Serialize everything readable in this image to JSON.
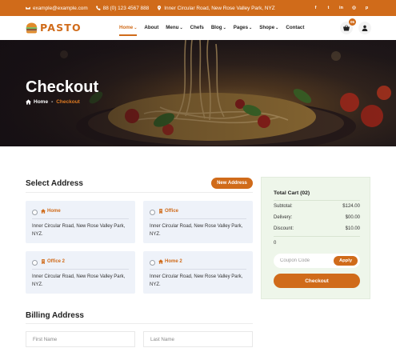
{
  "topbar": {
    "email": "example@example.com",
    "phone": "88 (0) 123 4567 888",
    "address": "Inner Circular Road, New Rose Valley Park, NYZ",
    "social_icons": [
      "facebook-icon",
      "twitter-icon",
      "linkedin-icon",
      "instagram-icon",
      "pinterest-icon"
    ],
    "social_glyphs": {
      "facebook": "f",
      "twitter": "t",
      "linkedin": "in",
      "instagram": "◎",
      "pinterest": "p"
    }
  },
  "header": {
    "logo_text": "PASTO",
    "nav": [
      {
        "label": "Home",
        "dropdown": true,
        "active": true
      },
      {
        "label": "About",
        "dropdown": false
      },
      {
        "label": "Menu",
        "dropdown": true
      },
      {
        "label": "Chefs",
        "dropdown": false
      },
      {
        "label": "Blog",
        "dropdown": true
      },
      {
        "label": "Pages",
        "dropdown": true
      },
      {
        "label": "Shope",
        "dropdown": true
      },
      {
        "label": "Contact",
        "dropdown": false
      }
    ],
    "cart_count": "05"
  },
  "hero": {
    "title": "Checkout",
    "breadcrumb_home": "Home",
    "breadcrumb_sep": "-",
    "breadcrumb_current": "Checkout"
  },
  "select_address": {
    "title": "Select Address",
    "new_address_button": "New Address",
    "cards": [
      {
        "label": "Home",
        "icon": "home-icon",
        "address": "Inner Circular Road, New Rose Valley Park, NYZ."
      },
      {
        "label": "Office",
        "icon": "building-icon",
        "address": "Inner Circular Road, New Rose Valley Park, NYZ."
      },
      {
        "label": "Office 2",
        "icon": "building-icon",
        "address": "Inner Circular Road, New Rose Valley Park, NYZ."
      },
      {
        "label": "Home 2",
        "icon": "home-icon",
        "address": "Inner Circular Road, New Rose Valley Park, NYZ."
      }
    ]
  },
  "billing": {
    "title": "Billing Address",
    "first_name_placeholder": "First Name",
    "last_name_placeholder": "Last Name"
  },
  "cart": {
    "title": "Total Cart (02)",
    "subtotal_label": "Subtotal:",
    "subtotal_value": "$124.00",
    "delivery_label": "Delivery:",
    "delivery_value": "$00.00",
    "discount_label": "Discount:",
    "discount_value": "$10.00",
    "total_value": "0",
    "coupon_placeholder": "Coupon Code",
    "apply_label": "Apply",
    "checkout_label": "Checkout"
  },
  "colors": {
    "accent": "#d06b1a",
    "card_bg": "#eef2f9",
    "sidebar_bg": "#eef6ea"
  }
}
